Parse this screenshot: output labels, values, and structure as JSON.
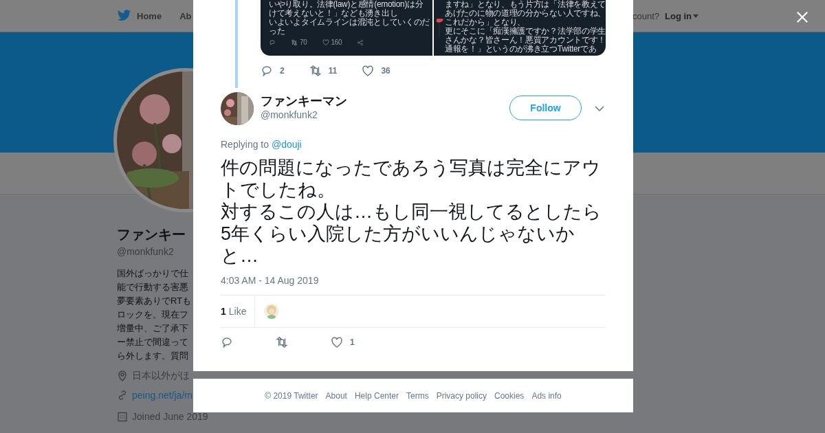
{
  "background_page": {
    "nav": {
      "items": [
        {
          "label": "Home"
        },
        {
          "label": "Ab"
        }
      ],
      "account_prompt": "count?",
      "login": "Log in"
    },
    "profile": {
      "name": "ファンキー",
      "handle": "@monkfunk2",
      "bio_lines": [
        "国外ばっかりで仕",
        "能で行動する害悪",
        "夢要素ありでRTも",
        "ロックを。現在フ",
        "増量中、ご了承下",
        "ー禁止で間違って",
        "ら外します。質問"
      ],
      "location": "日本以外がほ",
      "link": "peing.net/ja/m",
      "joined": "Joined June 2019"
    }
  },
  "modal": {
    "parent_tweet": {
      "media": [
        {
          "lines": [
            "いやり取り。法律(law)と感情(emotion)は分",
            "けて考えないと！」なども湧き出し",
            "いよいよタイムラインは混沌としていくのだ",
            "った"
          ],
          "retweets": "70",
          "likes": "160"
        },
        {
          "lines": [
            "ますね」となり、もう片方は「法律を教えて",
            "あげたのに物の道理の分からない人ですね、",
            "これだから」となり、",
            "更にそこに「痴漢擁護ですか？法学部の学生",
            "さんかな？皆さーん！悪質アカウントです！",
            "通報を！」というのが沸き立つTwitterであ"
          ]
        }
      ],
      "replies": "2",
      "retweets": "11",
      "likes": "36"
    },
    "tweet": {
      "name": "ファンキーマン",
      "handle": "@monkfunk2",
      "follow": "Follow",
      "replying_prefix": "Replying to",
      "replying_to": "@douji",
      "text": [
        "件の問題になったであろう写真は完全にアウトでしたね。",
        "対するこの人は…もし同一視してるとしたら5年くらい入院した方がいいんじゃないかと…"
      ],
      "timestamp": "4:03 AM - 14 Aug 2019",
      "like_count": "1",
      "like_label": "Like",
      "likes": "1"
    },
    "footer": [
      "© 2019 Twitter",
      "About",
      "Help Center",
      "Terms",
      "Privacy policy",
      "Cookies",
      "Ads info"
    ]
  }
}
